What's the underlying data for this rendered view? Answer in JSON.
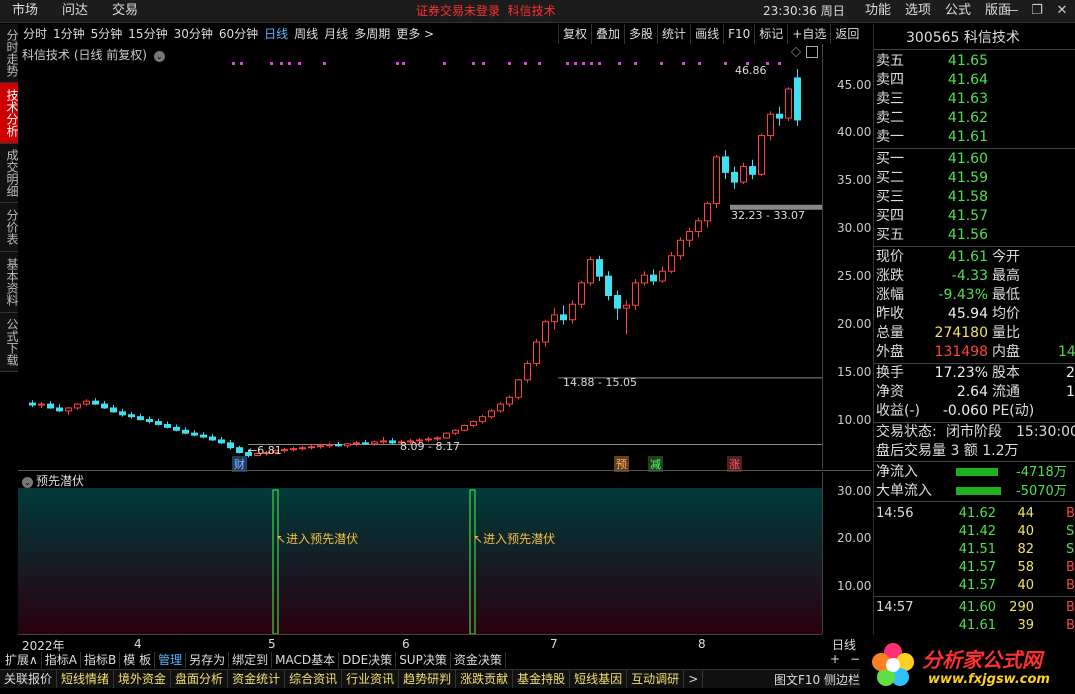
{
  "top_menu": [
    "市场",
    "问达",
    "交易"
  ],
  "login_status": "证券交易未登录",
  "stock_name_top": "科信技术",
  "clock": "23:30:36 周日",
  "right_menu": [
    "功能",
    "选项",
    "公式",
    "版面"
  ],
  "window_controls": [
    "—",
    "❐",
    "✕"
  ],
  "side_tabs": [
    "分时走势",
    "技术分析",
    "成交明细",
    "分价表",
    "基本资料",
    "公式下载"
  ],
  "periods": [
    "分时",
    "1分钟",
    "5分钟",
    "15分钟",
    "30分钟",
    "60分钟",
    "日线",
    "周线",
    "月线",
    "多周期",
    "更多 >"
  ],
  "active_period": "日线",
  "tools": [
    "复权",
    "叠加",
    "多股",
    "统计",
    "画线",
    "F10",
    "标记",
    "+自选",
    "返回"
  ],
  "chart_title": "科信技术 (日线 前复权)",
  "y_ticks": [
    "45.00",
    "40.00",
    "35.00",
    "30.00",
    "25.00",
    "20.00",
    "15.00",
    "10.00"
  ],
  "annotations": {
    "high": "46.86",
    "low": "6.81",
    "range1": "8.09 - 8.17",
    "range2": "14.88 - 15.05",
    "range3": "32.23 - 33.07"
  },
  "event_badges": [
    "财",
    "预",
    "减",
    "涨"
  ],
  "indicator": {
    "title": "预先潜伏",
    "y_ticks": [
      "30.00",
      "20.00",
      "10.00"
    ],
    "signal_label": "进入预先潜伏"
  },
  "x_labels": [
    "2022年",
    "4",
    "5",
    "6",
    "7",
    "8"
  ],
  "x_right": "日线",
  "quote": {
    "code": "300565",
    "name": "科信技术",
    "asks": [
      {
        "label": "卖五",
        "price": "41.65"
      },
      {
        "label": "卖四",
        "price": "41.64"
      },
      {
        "label": "卖三",
        "price": "41.63"
      },
      {
        "label": "卖二",
        "price": "41.62"
      },
      {
        "label": "卖一",
        "price": "41.61"
      }
    ],
    "bids": [
      {
        "label": "买一",
        "price": "41.60"
      },
      {
        "label": "买二",
        "price": "41.59"
      },
      {
        "label": "买三",
        "price": "41.58"
      },
      {
        "label": "买四",
        "price": "41.57"
      },
      {
        "label": "买五",
        "price": "41.56"
      }
    ],
    "stats": [
      {
        "l1": "现价",
        "v1": "41.61",
        "c1": "grn",
        "l2": "今开",
        "v2": ""
      },
      {
        "l1": "涨跌",
        "v1": "-4.33",
        "c1": "grn",
        "l2": "最高",
        "v2": ""
      },
      {
        "l1": "涨幅",
        "v1": "-9.43%",
        "c1": "grn",
        "l2": "最低",
        "v2": ""
      },
      {
        "l1": "昨收",
        "v1": "45.94",
        "c1": "wht",
        "l2": "均价",
        "v2": ""
      },
      {
        "l1": "总量",
        "v1": "274180",
        "c1": "yel",
        "l2": "量比",
        "v2": ""
      },
      {
        "l1": "外盘",
        "v1": "131498",
        "c1": "red",
        "l2": "内盘",
        "v2": "14"
      }
    ],
    "stats2": [
      {
        "l1": "换手",
        "v1": "17.23%",
        "l2": "股本",
        "v2": "2"
      },
      {
        "l1": "净资",
        "v1": "2.64",
        "l2": "流通",
        "v2": "1"
      },
      {
        "l1": "收益(-)",
        "v1": "-0.060",
        "l2": "PE(动)",
        "v2": ""
      }
    ],
    "trade_status_label": "交易状态:",
    "trade_status": "闭市阶段",
    "trade_time": "15:30:00",
    "after_hours": "盘后交易量 3 额 1.2万",
    "net_inflow_label": "净流入",
    "net_inflow": "-4718万",
    "big_inflow_label": "大单流入",
    "big_inflow": "-5070万",
    "ticks": [
      {
        "t": "14:56",
        "p": "41.62",
        "v": "44",
        "c": "grn",
        "vc": "yel",
        "bs": "B"
      },
      {
        "t": "",
        "p": "41.42",
        "v": "40",
        "c": "grn",
        "vc": "yel",
        "bs": "S"
      },
      {
        "t": "",
        "p": "41.51",
        "v": "82",
        "c": "grn",
        "vc": "yel",
        "bs": "S"
      },
      {
        "t": "",
        "p": "41.57",
        "v": "58",
        "c": "grn",
        "vc": "yel",
        "bs": "B"
      },
      {
        "t": "",
        "p": "41.57",
        "v": "40",
        "c": "grn",
        "vc": "yel",
        "bs": "B"
      },
      {
        "t": "14:57",
        "p": "41.60",
        "v": "290",
        "c": "grn",
        "vc": "yel",
        "bs": "B"
      },
      {
        "t": "",
        "p": "41.61",
        "v": "39",
        "c": "grn",
        "vc": "yel",
        "bs": "B"
      }
    ]
  },
  "bottom_bar1": [
    "扩展∧",
    "指标A",
    "指标B",
    "模 板",
    "管理",
    "另存为",
    "绑定到",
    "MACD基本",
    "DDE决策",
    "SUP决策",
    "资金决策"
  ],
  "bottom_bar1_active": "管理",
  "bottom_bar2": [
    "关联报价",
    "短线情绪",
    "境外资金",
    "盘面分析",
    "资金统计",
    "综合资讯",
    "行业资讯",
    "趋势研判",
    "涨跌贡献",
    "基金持股",
    "短线基因",
    "互动调研",
    ">"
  ],
  "bottom_right": "图文F10 侧边栏",
  "brand": {
    "name": "分析家公式网",
    "url": "www.fxjgsw.com"
  },
  "colors": {
    "up": "#ff4040",
    "down": "#40e0f0",
    "signal": "#40ff40",
    "accent": "#5ab4ff"
  },
  "chart_data": {
    "type": "candlestick",
    "ylim": [
      5.5,
      48
    ],
    "candles": [
      [
        12.4,
        12.7,
        12.0,
        12.2
      ],
      [
        12.2,
        12.5,
        11.9,
        12.3
      ],
      [
        12.3,
        12.6,
        11.8,
        11.9
      ],
      [
        11.9,
        12.3,
        11.5,
        11.6
      ],
      [
        11.6,
        12.0,
        11.2,
        11.9
      ],
      [
        11.9,
        12.4,
        11.7,
        12.3
      ],
      [
        12.3,
        12.8,
        12.1,
        12.6
      ],
      [
        12.6,
        12.9,
        12.2,
        12.3
      ],
      [
        12.3,
        12.6,
        11.8,
        11.9
      ],
      [
        11.9,
        12.2,
        11.4,
        11.5
      ],
      [
        11.5,
        11.8,
        11.0,
        11.2
      ],
      [
        11.2,
        11.5,
        10.8,
        11.0
      ],
      [
        11.0,
        11.3,
        10.6,
        10.7
      ],
      [
        10.7,
        11.0,
        10.3,
        10.5
      ],
      [
        10.5,
        10.8,
        10.1,
        10.2
      ],
      [
        10.2,
        10.5,
        9.8,
        9.9
      ],
      [
        9.9,
        10.2,
        9.5,
        9.6
      ],
      [
        9.6,
        9.9,
        9.2,
        9.3
      ],
      [
        9.3,
        9.6,
        9.0,
        9.1
      ],
      [
        9.1,
        9.4,
        8.8,
        8.9
      ],
      [
        8.9,
        9.2,
        8.5,
        8.6
      ],
      [
        8.6,
        8.9,
        8.2,
        8.3
      ],
      [
        8.3,
        8.6,
        7.6,
        7.8
      ],
      [
        7.8,
        8.0,
        7.2,
        7.3
      ],
      [
        7.3,
        7.6,
        6.81,
        7.0
      ],
      [
        7.0,
        7.3,
        6.9,
        7.2
      ],
      [
        7.2,
        7.5,
        7.0,
        7.3
      ],
      [
        7.3,
        7.6,
        7.1,
        7.5
      ],
      [
        7.5,
        7.8,
        7.3,
        7.6
      ],
      [
        7.6,
        7.9,
        7.4,
        7.7
      ],
      [
        7.7,
        8.0,
        7.5,
        7.8
      ],
      [
        7.8,
        8.1,
        7.6,
        7.9
      ],
      [
        7.9,
        8.2,
        7.7,
        8.0
      ],
      [
        8.0,
        8.3,
        7.8,
        8.1
      ],
      [
        8.1,
        8.4,
        7.9,
        8.0
      ],
      [
        8.0,
        8.3,
        7.8,
        8.2
      ],
      [
        8.2,
        8.5,
        8.0,
        8.3
      ],
      [
        8.3,
        8.6,
        8.1,
        8.2
      ],
      [
        8.2,
        8.5,
        8.0,
        8.4
      ],
      [
        8.4,
        8.9,
        8.2,
        8.5
      ],
      [
        8.5,
        8.8,
        8.2,
        8.3
      ],
      [
        8.3,
        8.6,
        8.1,
        8.4
      ],
      [
        8.4,
        8.7,
        8.2,
        8.5
      ],
      [
        8.5,
        8.8,
        8.3,
        8.6
      ],
      [
        8.6,
        8.9,
        8.4,
        8.7
      ],
      [
        8.7,
        9.0,
        8.5,
        8.8
      ],
      [
        8.8,
        9.4,
        8.7,
        9.3
      ],
      [
        9.3,
        9.7,
        9.1,
        9.6
      ],
      [
        9.6,
        10.2,
        9.5,
        10.1
      ],
      [
        10.1,
        10.6,
        9.9,
        10.5
      ],
      [
        10.5,
        11.2,
        10.3,
        11.0
      ],
      [
        11.0,
        11.8,
        10.8,
        11.6
      ],
      [
        11.6,
        12.5,
        11.4,
        12.3
      ],
      [
        12.3,
        13.2,
        12.0,
        13.0
      ],
      [
        13.0,
        14.9,
        12.8,
        14.8
      ],
      [
        14.8,
        16.8,
        14.5,
        16.5
      ],
      [
        16.5,
        19.0,
        16.2,
        18.7
      ],
      [
        18.7,
        21.0,
        18.2,
        20.8
      ],
      [
        20.8,
        22.2,
        20.0,
        21.5
      ],
      [
        21.5,
        22.5,
        20.5,
        21.0
      ],
      [
        21.0,
        23.0,
        20.6,
        22.6
      ],
      [
        22.6,
        25.0,
        22.2,
        24.8
      ],
      [
        24.8,
        27.5,
        24.5,
        27.2
      ],
      [
        27.2,
        27.6,
        25.0,
        25.5
      ],
      [
        25.5,
        26.0,
        23.0,
        23.5
      ],
      [
        23.5,
        24.0,
        21.0,
        22.2
      ],
      [
        22.2,
        23.0,
        19.5,
        22.5
      ],
      [
        22.5,
        25.2,
        22.0,
        24.8
      ],
      [
        24.8,
        26.0,
        24.5,
        25.6
      ],
      [
        25.6,
        26.2,
        24.6,
        25.0
      ],
      [
        25.0,
        26.5,
        24.8,
        26.0
      ],
      [
        26.0,
        28.0,
        25.8,
        27.6
      ],
      [
        27.6,
        29.5,
        27.2,
        29.2
      ],
      [
        29.2,
        30.5,
        28.5,
        30.1
      ],
      [
        30.1,
        31.5,
        29.5,
        31.2
      ],
      [
        31.2,
        33.2,
        30.5,
        33.0
      ],
      [
        33.0,
        38.0,
        32.5,
        37.8
      ],
      [
        37.8,
        38.5,
        35.5,
        36.2
      ],
      [
        36.2,
        36.8,
        34.5,
        35.2
      ],
      [
        35.2,
        37.2,
        35.0,
        36.8
      ],
      [
        36.8,
        37.5,
        35.5,
        36.0
      ],
      [
        36.0,
        40.2,
        35.8,
        40.0
      ],
      [
        40.0,
        42.5,
        39.5,
        42.2
      ],
      [
        42.2,
        43.0,
        41.0,
        41.8
      ],
      [
        41.8,
        45.0,
        41.5,
        44.8
      ],
      [
        45.94,
        46.86,
        41.0,
        41.61
      ]
    ]
  }
}
